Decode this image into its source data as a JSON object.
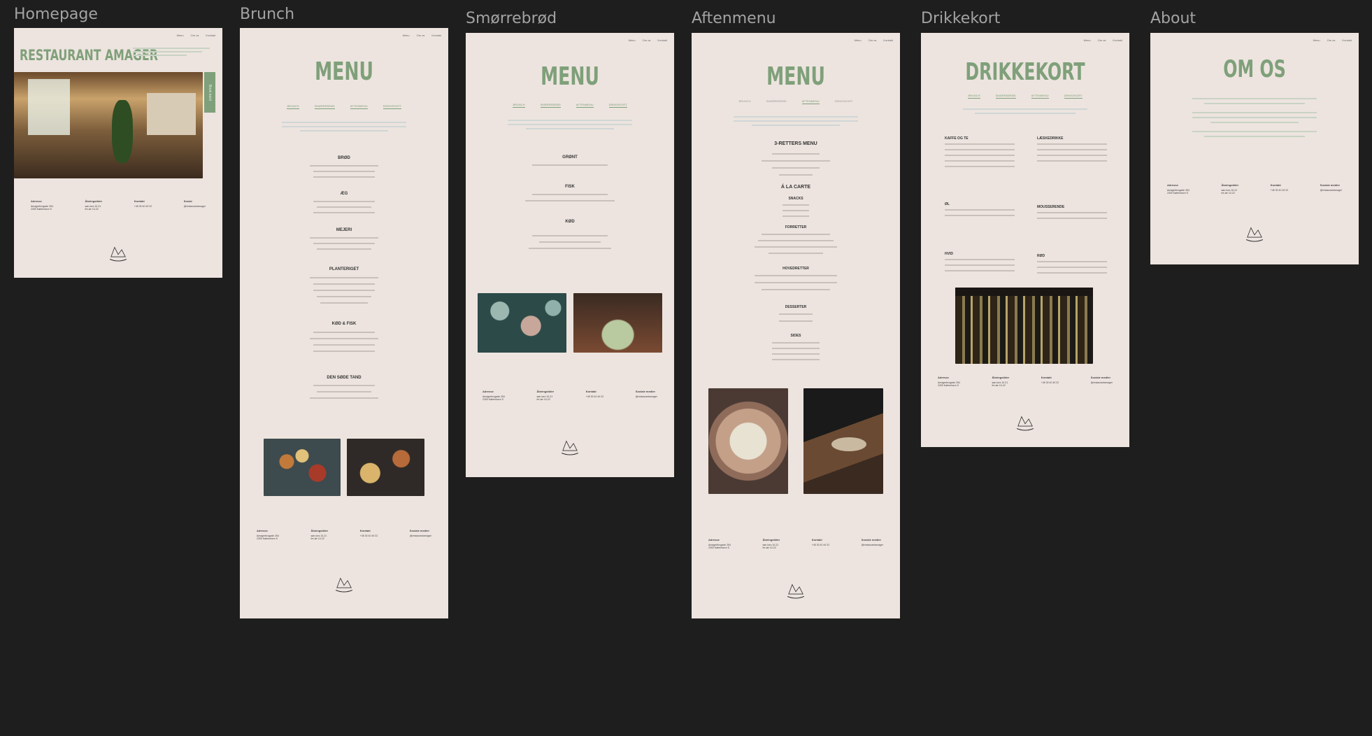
{
  "labels": {
    "homepage": "Homepage",
    "brunch": "Brunch",
    "smorrebrod": "Smørrebrød",
    "aftenmenu": "Aftenmenu",
    "drikkekort": "Drikkekort",
    "about": "About"
  },
  "colors": {
    "canvas": "#1e1e1e",
    "page": "#ede4df",
    "accent": "#7fa07a"
  },
  "nav": {
    "menu": "Menu",
    "about": "Om os",
    "contact": "Kontakt"
  },
  "home": {
    "title": "RESTAURANT AMAGER",
    "book": "Book bord"
  },
  "brunch": {
    "title": "MENU",
    "cats": [
      "Brunch",
      "Smørrebrød",
      "Aftenmenu",
      "Drikkekort"
    ],
    "sections": [
      "BRØD",
      "ÆG",
      "MEJERI",
      "PLANTERIGET",
      "KØD & FISK",
      "DEN SØDE TAND"
    ]
  },
  "smor": {
    "title": "MENU",
    "sections": [
      "GRØNT",
      "FISK",
      "KØD"
    ]
  },
  "aften": {
    "title": "MENU",
    "cats": [
      "BRUNCH",
      "SMØRREBRØD",
      "AFTENMENU",
      "DRIKKEKORT"
    ],
    "sections": [
      "3-RETTERS MENU",
      "Á LA CARTE",
      "SNACKS",
      "FORRETTER",
      "HOVEDRETTER",
      "DESSERTER",
      "SIDES"
    ]
  },
  "drinks": {
    "title": "DRIKKEKORT",
    "cats": [
      "Brunch",
      "Smørrebrød",
      "Aftenmenu",
      "Drikkekort"
    ],
    "sections": [
      "KAFFE OG TE",
      "LÆSKEDRIKKE",
      "ØL",
      "MOUSSERENDE",
      "HVID",
      "RØD"
    ]
  },
  "about": {
    "title": "OM OS"
  },
  "footer": {
    "address_h": "Adresse",
    "hours_h": "Åbningstider",
    "contact_h": "Kontakt",
    "social_h": "Sociale medier"
  }
}
